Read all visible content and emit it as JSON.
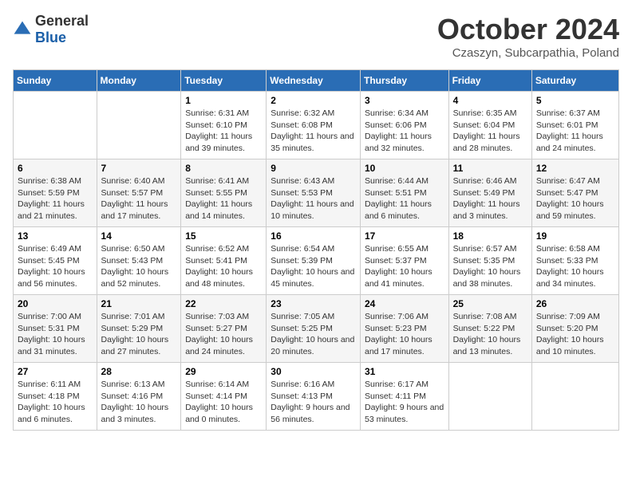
{
  "header": {
    "logo_general": "General",
    "logo_blue": "Blue",
    "month": "October 2024",
    "location": "Czaszyn, Subcarpathia, Poland"
  },
  "days_of_week": [
    "Sunday",
    "Monday",
    "Tuesday",
    "Wednesday",
    "Thursday",
    "Friday",
    "Saturday"
  ],
  "weeks": [
    [
      {
        "day": "",
        "info": ""
      },
      {
        "day": "",
        "info": ""
      },
      {
        "day": "1",
        "info": "Sunrise: 6:31 AM\nSunset: 6:10 PM\nDaylight: 11 hours and 39 minutes."
      },
      {
        "day": "2",
        "info": "Sunrise: 6:32 AM\nSunset: 6:08 PM\nDaylight: 11 hours and 35 minutes."
      },
      {
        "day": "3",
        "info": "Sunrise: 6:34 AM\nSunset: 6:06 PM\nDaylight: 11 hours and 32 minutes."
      },
      {
        "day": "4",
        "info": "Sunrise: 6:35 AM\nSunset: 6:04 PM\nDaylight: 11 hours and 28 minutes."
      },
      {
        "day": "5",
        "info": "Sunrise: 6:37 AM\nSunset: 6:01 PM\nDaylight: 11 hours and 24 minutes."
      }
    ],
    [
      {
        "day": "6",
        "info": "Sunrise: 6:38 AM\nSunset: 5:59 PM\nDaylight: 11 hours and 21 minutes."
      },
      {
        "day": "7",
        "info": "Sunrise: 6:40 AM\nSunset: 5:57 PM\nDaylight: 11 hours and 17 minutes."
      },
      {
        "day": "8",
        "info": "Sunrise: 6:41 AM\nSunset: 5:55 PM\nDaylight: 11 hours and 14 minutes."
      },
      {
        "day": "9",
        "info": "Sunrise: 6:43 AM\nSunset: 5:53 PM\nDaylight: 11 hours and 10 minutes."
      },
      {
        "day": "10",
        "info": "Sunrise: 6:44 AM\nSunset: 5:51 PM\nDaylight: 11 hours and 6 minutes."
      },
      {
        "day": "11",
        "info": "Sunrise: 6:46 AM\nSunset: 5:49 PM\nDaylight: 11 hours and 3 minutes."
      },
      {
        "day": "12",
        "info": "Sunrise: 6:47 AM\nSunset: 5:47 PM\nDaylight: 10 hours and 59 minutes."
      }
    ],
    [
      {
        "day": "13",
        "info": "Sunrise: 6:49 AM\nSunset: 5:45 PM\nDaylight: 10 hours and 56 minutes."
      },
      {
        "day": "14",
        "info": "Sunrise: 6:50 AM\nSunset: 5:43 PM\nDaylight: 10 hours and 52 minutes."
      },
      {
        "day": "15",
        "info": "Sunrise: 6:52 AM\nSunset: 5:41 PM\nDaylight: 10 hours and 48 minutes."
      },
      {
        "day": "16",
        "info": "Sunrise: 6:54 AM\nSunset: 5:39 PM\nDaylight: 10 hours and 45 minutes."
      },
      {
        "day": "17",
        "info": "Sunrise: 6:55 AM\nSunset: 5:37 PM\nDaylight: 10 hours and 41 minutes."
      },
      {
        "day": "18",
        "info": "Sunrise: 6:57 AM\nSunset: 5:35 PM\nDaylight: 10 hours and 38 minutes."
      },
      {
        "day": "19",
        "info": "Sunrise: 6:58 AM\nSunset: 5:33 PM\nDaylight: 10 hours and 34 minutes."
      }
    ],
    [
      {
        "day": "20",
        "info": "Sunrise: 7:00 AM\nSunset: 5:31 PM\nDaylight: 10 hours and 31 minutes."
      },
      {
        "day": "21",
        "info": "Sunrise: 7:01 AM\nSunset: 5:29 PM\nDaylight: 10 hours and 27 minutes."
      },
      {
        "day": "22",
        "info": "Sunrise: 7:03 AM\nSunset: 5:27 PM\nDaylight: 10 hours and 24 minutes."
      },
      {
        "day": "23",
        "info": "Sunrise: 7:05 AM\nSunset: 5:25 PM\nDaylight: 10 hours and 20 minutes."
      },
      {
        "day": "24",
        "info": "Sunrise: 7:06 AM\nSunset: 5:23 PM\nDaylight: 10 hours and 17 minutes."
      },
      {
        "day": "25",
        "info": "Sunrise: 7:08 AM\nSunset: 5:22 PM\nDaylight: 10 hours and 13 minutes."
      },
      {
        "day": "26",
        "info": "Sunrise: 7:09 AM\nSunset: 5:20 PM\nDaylight: 10 hours and 10 minutes."
      }
    ],
    [
      {
        "day": "27",
        "info": "Sunrise: 6:11 AM\nSunset: 4:18 PM\nDaylight: 10 hours and 6 minutes."
      },
      {
        "day": "28",
        "info": "Sunrise: 6:13 AM\nSunset: 4:16 PM\nDaylight: 10 hours and 3 minutes."
      },
      {
        "day": "29",
        "info": "Sunrise: 6:14 AM\nSunset: 4:14 PM\nDaylight: 10 hours and 0 minutes."
      },
      {
        "day": "30",
        "info": "Sunrise: 6:16 AM\nSunset: 4:13 PM\nDaylight: 9 hours and 56 minutes."
      },
      {
        "day": "31",
        "info": "Sunrise: 6:17 AM\nSunset: 4:11 PM\nDaylight: 9 hours and 53 minutes."
      },
      {
        "day": "",
        "info": ""
      },
      {
        "day": "",
        "info": ""
      }
    ]
  ]
}
